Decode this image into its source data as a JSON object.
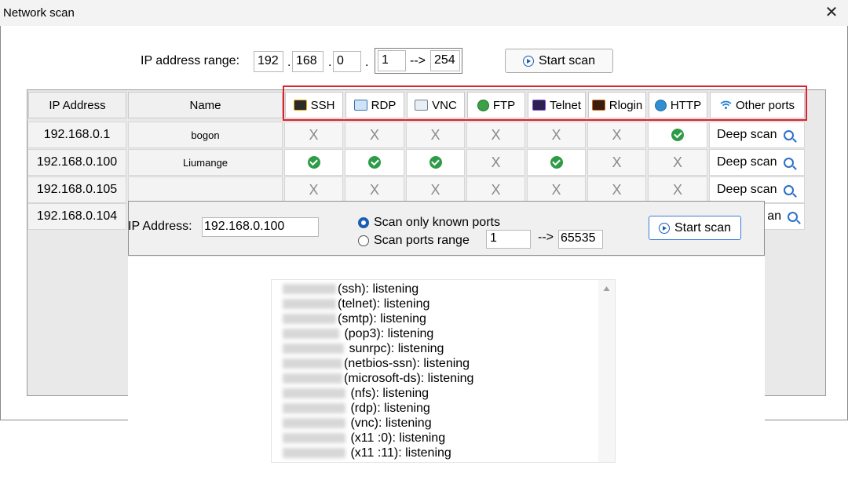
{
  "window": {
    "title": "Network scan",
    "close_glyph": "✕"
  },
  "range": {
    "label": "IP address range:",
    "octet1": "192",
    "octet2": "168",
    "octet3": "0",
    "start": "1",
    "arrow": "-->",
    "end": "254",
    "scan_button": "Start scan"
  },
  "table": {
    "headers": {
      "ip": "IP Address",
      "name": "Name",
      "ssh": "SSH",
      "rdp": "RDP",
      "vnc": "VNC",
      "ftp": "FTP",
      "telnet": "Telnet",
      "rlogin": "Rlogin",
      "http": "HTTP",
      "other": "Other ports"
    },
    "rows": [
      {
        "ip": "192.168.0.1",
        "name": "bogon",
        "ports": [
          "X",
          "X",
          "X",
          "X",
          "X",
          "X",
          "ok"
        ],
        "deep": "Deep scan"
      },
      {
        "ip": "192.168.0.100",
        "name": "Liumange",
        "ports": [
          "ok",
          "ok",
          "ok",
          "X",
          "ok",
          "X",
          "X"
        ],
        "deep": "Deep scan"
      },
      {
        "ip": "192.168.0.105",
        "name": "",
        "ports": [
          "X",
          "X",
          "X",
          "X",
          "X",
          "X",
          "X"
        ],
        "deep": "Deep scan"
      },
      {
        "ip": "192.168.0.104",
        "name": "",
        "deep_partial": "an"
      }
    ]
  },
  "deep_scan": {
    "ip_label": "IP Address:",
    "ip_value": "192.168.0.100",
    "radio_known": "Scan only known ports",
    "radio_range": "Scan ports range",
    "range_start": "1",
    "range_arrow": "-->",
    "range_end": "65535",
    "scan_button": "Start scan"
  },
  "results": [
    "(ssh):  listening",
    "(telnet):  listening",
    "(smtp):  listening",
    " (pop3):  listening",
    " sunrpc):  listening",
    "(netbios-ssn):  listening",
    "(microsoft-ds):  listening",
    " (nfs):  listening",
    " (rdp):  listening",
    " (vnc):  listening",
    " (x11 :0):  listening",
    " (x11 :11):  listening"
  ],
  "colors": {
    "check": "#2e9c47",
    "highlight_border": "#e0202a",
    "accent": "#1a5fb4"
  }
}
